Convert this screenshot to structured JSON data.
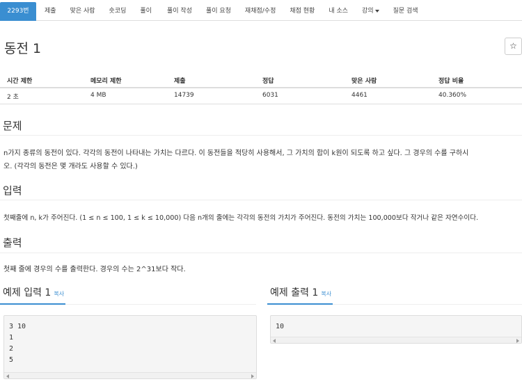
{
  "nav": {
    "tabs": [
      {
        "label": "2293번"
      },
      {
        "label": "제출"
      },
      {
        "label": "맞은 사람"
      },
      {
        "label": "숏코딩"
      },
      {
        "label": "풀이"
      },
      {
        "label": "풀이 작성"
      },
      {
        "label": "풀이 요청"
      },
      {
        "label": "재채점/수정"
      },
      {
        "label": "채점 현황"
      },
      {
        "label": "내 소스"
      },
      {
        "label": "강의"
      },
      {
        "label": "질문 검색"
      }
    ]
  },
  "problem": {
    "title": "동전 1",
    "star": "☆"
  },
  "info": {
    "headers": [
      "시간 제한",
      "메모리 제한",
      "제출",
      "정답",
      "맞은 사람",
      "정답 비율"
    ],
    "values": [
      "2 초",
      "4 MB",
      "14739",
      "6031",
      "4461",
      "40.360%"
    ]
  },
  "sections": {
    "description": {
      "heading": "문제",
      "line1": "n가지 종류의 동전이 있다. 각각의 동전이 나타내는 가치는 다르다. 이 동전들을 적당히 사용해서, 그 가치의 합이 k원이 되도록 하고 싶다. 그 경우의 수를 구하시",
      "line2": "오. (각각의 동전은 몇 개라도 사용할 수 있다.)"
    },
    "input": {
      "heading": "입력",
      "text": "첫째줄에 n, k가 주어진다. (1 ≤ n ≤ 100, 1 ≤ k ≤ 10,000) 다음 n개의 줄에는 각각의 동전의 가치가 주어진다. 동전의 가치는 100,000보다 작거나 같은 자연수이다."
    },
    "output": {
      "heading": "출력",
      "text": "첫째 줄에 경우의 수를 출력한다. 경우의 수는 2^31보다 작다."
    }
  },
  "samples": {
    "input": {
      "title": "예제 입력 1",
      "copy": "복사",
      "content": "3 10\n1\n2\n5"
    },
    "output": {
      "title": "예제 출력 1",
      "copy": "복사",
      "content": "10"
    }
  },
  "colors": {
    "accent": "#3a8ed1",
    "border": "#dddddd",
    "pre_bg": "#f5f5f5"
  }
}
